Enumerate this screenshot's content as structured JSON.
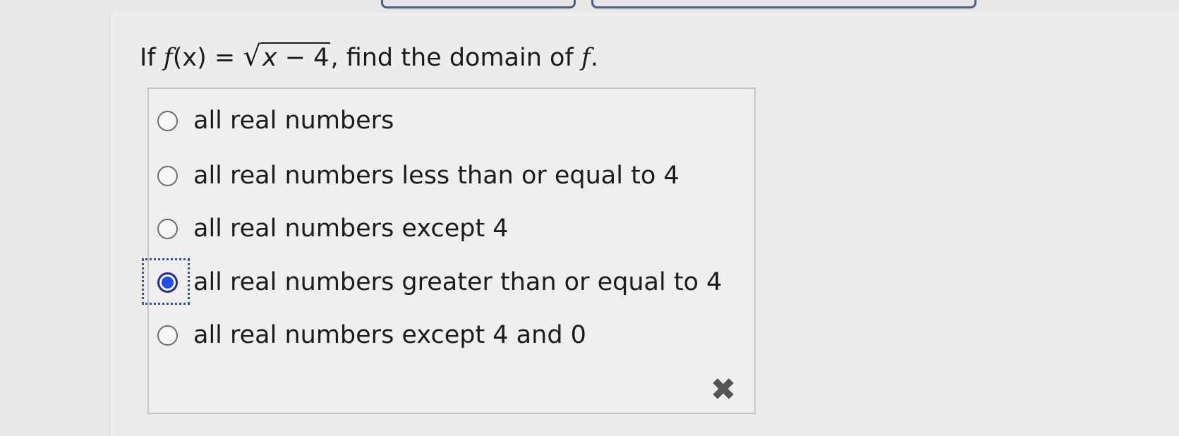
{
  "question": {
    "prefix": "If ",
    "function_name": "f",
    "function_arg": "(x) = ",
    "radicand_var": "x",
    "radicand_rest": " − 4",
    "suffix": ", find the domain of ",
    "suffix_var": "f",
    "end": "."
  },
  "choices": [
    {
      "label": "all real numbers",
      "selected": false
    },
    {
      "label": "all real numbers less than or equal to 4",
      "selected": false
    },
    {
      "label": "all real numbers except 4",
      "selected": false
    },
    {
      "label": "all real numbers greater than or equal to 4",
      "selected": true
    },
    {
      "label": "all real numbers except 4 and 0",
      "selected": false
    }
  ],
  "incorrect_mark": {
    "icon": "x-mark-icon",
    "symbol": "✖"
  },
  "colors": {
    "selected_fill": "#1f4fe8",
    "selected_border": "#1e2e8f",
    "focus_ring": "#3a4f92",
    "top_tab_border": "#4a5f8e"
  }
}
